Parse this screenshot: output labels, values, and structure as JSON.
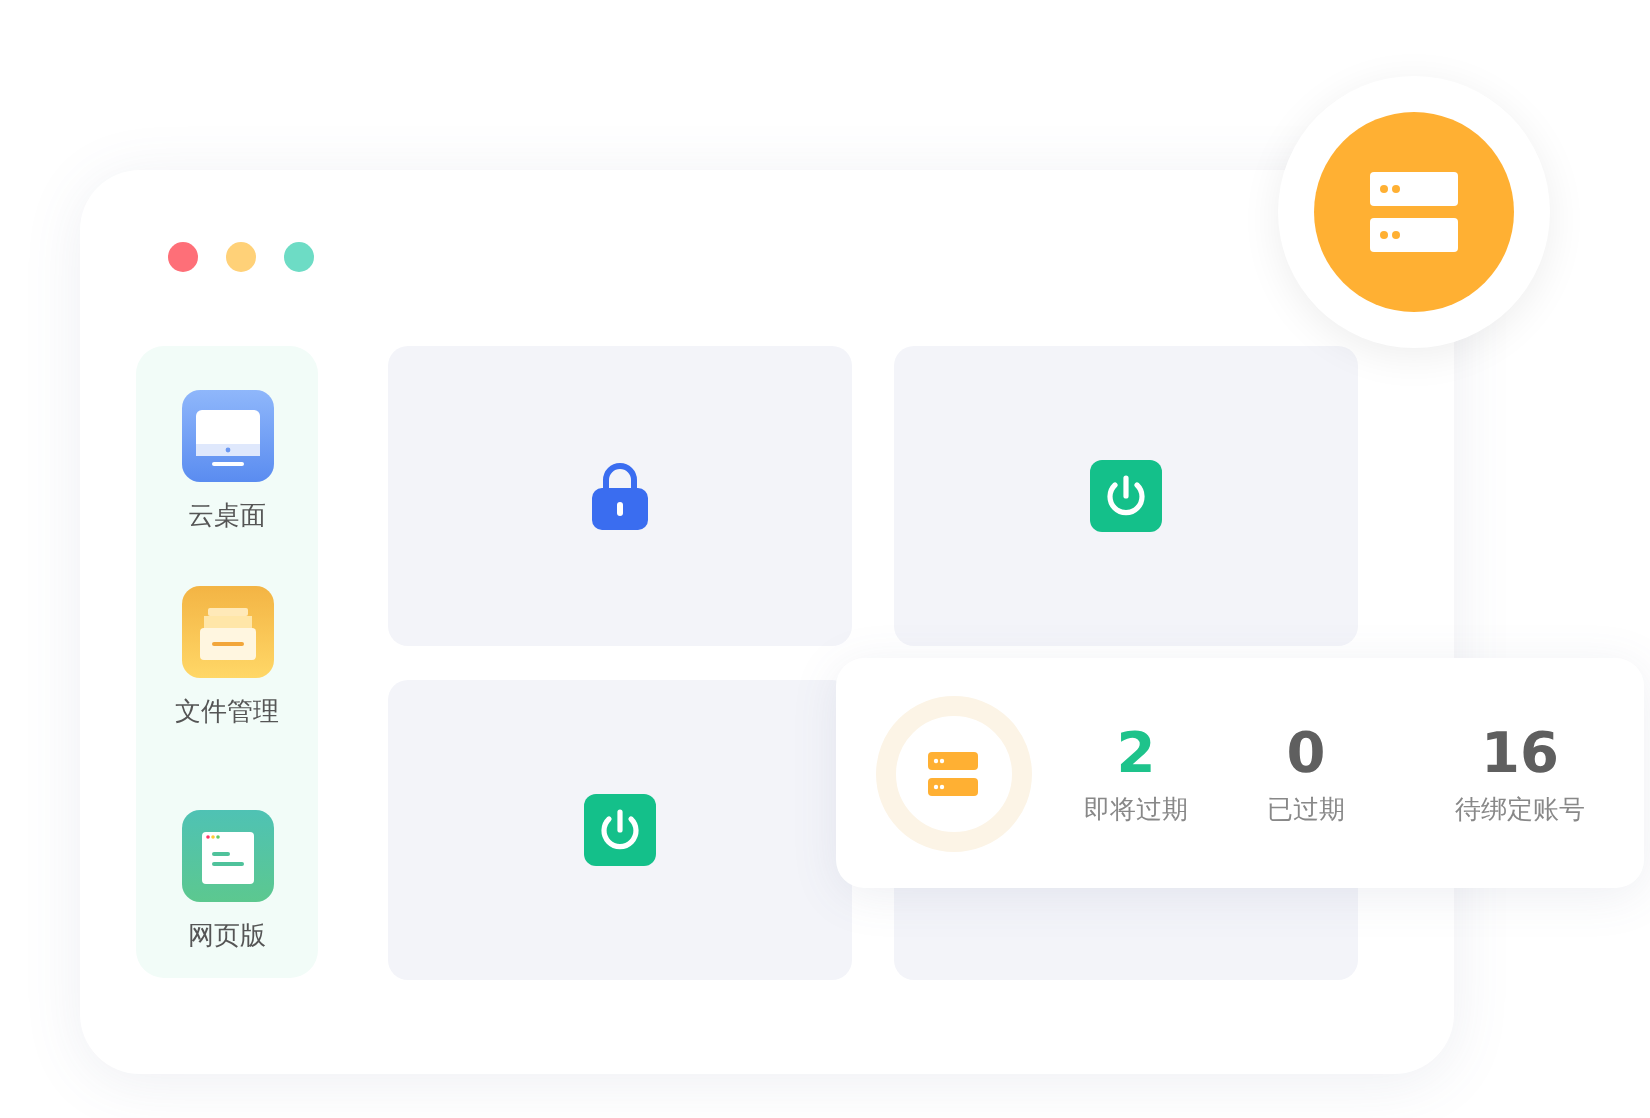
{
  "sidebar": {
    "items": [
      {
        "kind": "desktop",
        "label": "云桌面"
      },
      {
        "kind": "files",
        "label": "文件管理"
      },
      {
        "kind": "web",
        "label": "网页版"
      }
    ]
  },
  "tiles": [
    {
      "kind": "lock"
    },
    {
      "kind": "power"
    },
    {
      "kind": "power"
    },
    {
      "kind": "empty"
    }
  ],
  "stats": [
    {
      "value": "2",
      "label": "即将过期",
      "color": "#1ec38b"
    },
    {
      "value": "0",
      "label": "已过期",
      "color": "#5f5f5f"
    },
    {
      "value": "16",
      "label": "待绑定账号",
      "color": "#5f5f5f"
    }
  ]
}
